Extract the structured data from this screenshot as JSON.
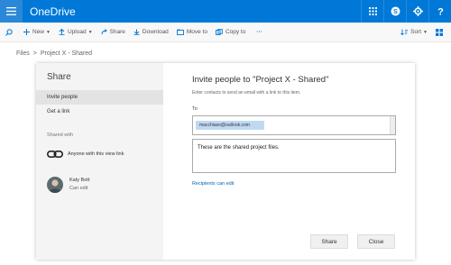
{
  "app": {
    "name": "OneDrive"
  },
  "toolbar": {
    "new_label": "New",
    "upload_label": "Upload",
    "share_label": "Share",
    "download_label": "Download",
    "moveto_label": "Move to",
    "copyto_label": "Copy to",
    "more_label": "···",
    "sort_label": "Sort"
  },
  "breadcrumb": {
    "root": "Files",
    "sep": ">",
    "current": "Project X - Shared"
  },
  "share_panel": {
    "title": "Share",
    "nav": [
      {
        "label": "Invite people"
      },
      {
        "label": "Get a link"
      }
    ],
    "shared_with_label": "Shared with",
    "link_entry": "Anyone with this view link",
    "user": {
      "name": "Katy Bott",
      "permission": "Can edit"
    }
  },
  "invite": {
    "heading": "Invite people to \"Project X - Shared\"",
    "instructions": "Enter contacts to send an email with a link to this item.",
    "to_label": "To",
    "recipient": "macchiaso@outlook.com",
    "message": "These are the shared project files.",
    "permission_link": "Recipients can edit",
    "share_button": "Share",
    "close_button": "Close"
  },
  "colors": {
    "brand": "#0078d7",
    "link": "#0063b1",
    "chip": "#bfd9f2"
  }
}
